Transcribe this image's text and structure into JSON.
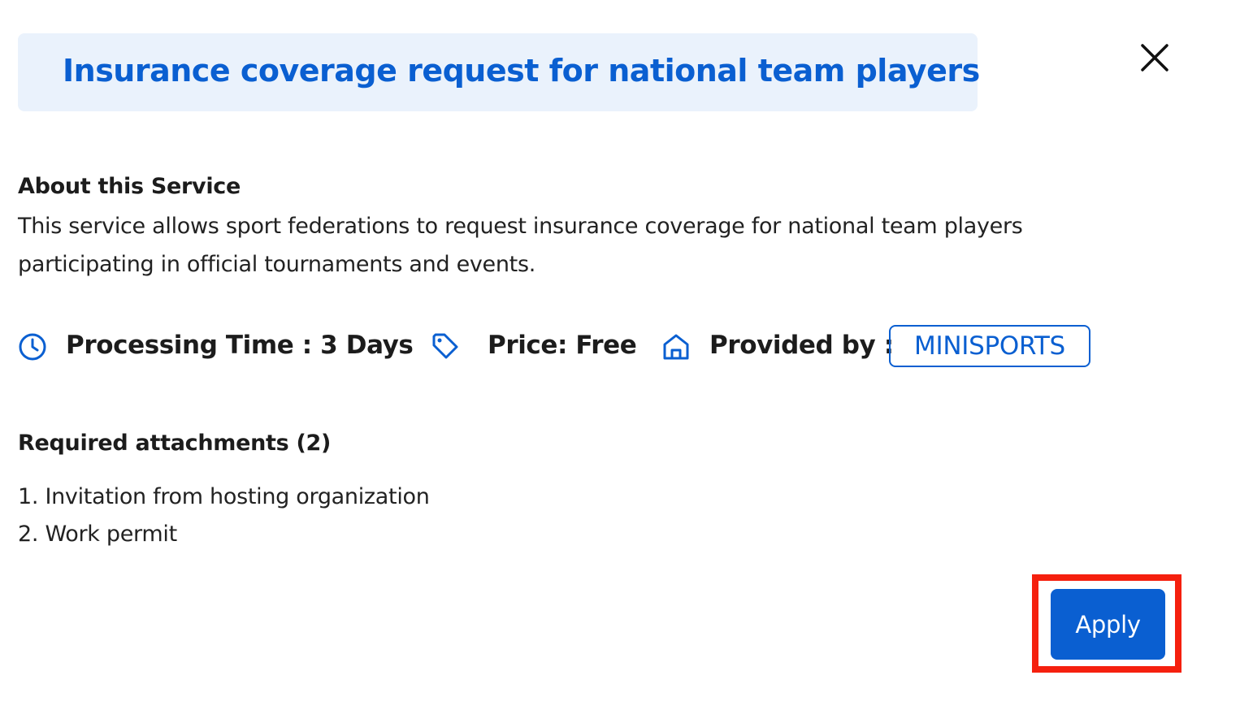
{
  "dialog": {
    "title": "Insurance coverage request for national team players",
    "close_icon": "close-icon"
  },
  "about": {
    "heading": "About this Service",
    "description": "This service allows sport federations to request insurance coverage for national team players participating in official tournaments and events."
  },
  "info": {
    "processing_icon": "clock-icon",
    "processing_time": "Processing Time : 3 Days",
    "price_icon": "tag-icon",
    "price": "Price: Free",
    "provider_icon": "home-icon",
    "provided_by_label": "Provided by :",
    "provider": "MINISPORTS"
  },
  "attachments": {
    "heading": "Required attachments (2)",
    "items": [
      "1. Invitation from hosting organization",
      "2. Work permit"
    ]
  },
  "actions": {
    "apply_label": "Apply"
  },
  "colors": {
    "accent": "#0a5fd1",
    "title_background": "#eaf2fc",
    "highlight": "#f5200e"
  }
}
